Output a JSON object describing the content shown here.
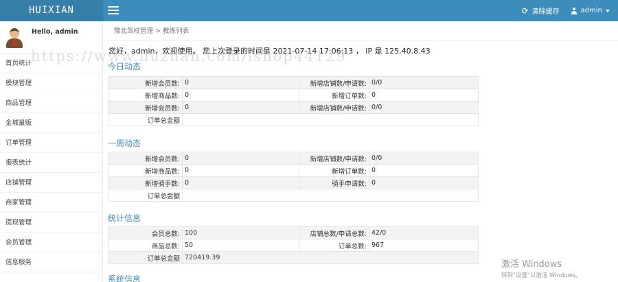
{
  "header": {
    "logo": "HUIXIAN",
    "clear_cache": "清除缓存",
    "user": "admin",
    "menu_toggle_icon": "hamburger-icon",
    "refresh_icon": "refresh-icon",
    "user_icon": "user-icon"
  },
  "sidebar": {
    "greeting": "Hello, admin",
    "items": [
      "首页统计",
      "模块管理",
      "商品管理",
      "金城量贩",
      "订单管理",
      "报表统计",
      "店铺管理",
      "商家管理",
      "提现管理",
      "会员管理",
      "信息服务"
    ]
  },
  "breadcrumb": {
    "part1": "豫北驾校管理",
    "sep": ">",
    "part2": "教练列表"
  },
  "welcome": "您好，admin，欢迎使用。 您上次登录的时间是 2021-07-14 17:06:13 ， IP 是 125.40.8.43",
  "today": {
    "title": "今日动态",
    "rows": [
      {
        "l1": "新增会员数:",
        "v1": "0",
        "l2": "新增店铺数/申请数:",
        "v2": "0/0"
      },
      {
        "l1": "新增商品数:",
        "v1": "0",
        "l2": "新增订单数:",
        "v2": "0"
      },
      {
        "l1": "新增会员数:",
        "v1": "0",
        "l2": "新增店铺数/申请数:",
        "v2": "0/0"
      },
      {
        "l1": "订单总金额",
        "v1": ""
      }
    ]
  },
  "week": {
    "title": "一周动态",
    "rows": [
      {
        "l1": "新增会员数:",
        "v1": "0",
        "l2": "新增店铺数/申请数:",
        "v2": "0/0"
      },
      {
        "l1": "新增商品数:",
        "v1": "0",
        "l2": "新增订单数:",
        "v2": "0"
      },
      {
        "l1": "新增骑手数:",
        "v1": "0",
        "l2": "骑手申请数:",
        "v2": "0"
      },
      {
        "l1": "订单总金额",
        "v1": ""
      }
    ]
  },
  "stats": {
    "title": "统计信息",
    "rows": [
      {
        "l1": "会员总数:",
        "v1": "100",
        "l2": "店铺总数/申请总数:",
        "v2": "42/0"
      },
      {
        "l1": "商品总数:",
        "v1": "50",
        "l2": "订单总数:",
        "v2": "967"
      },
      {
        "l1": "订单总金额",
        "v1": "720419.39"
      }
    ]
  },
  "system_title": "系统信息",
  "watermark": "https://www.huzhan.com/ishop44129",
  "activation": {
    "line1": "激活 Windows",
    "line2": "转到\"设置\"以激活 Windows。"
  }
}
